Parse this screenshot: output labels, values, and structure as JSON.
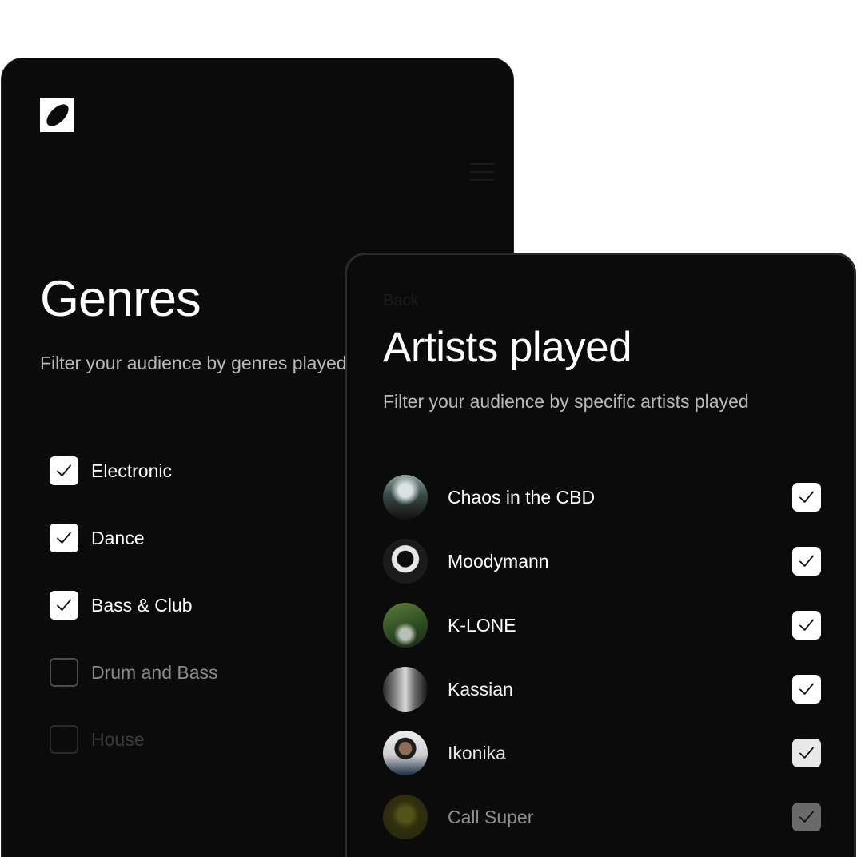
{
  "genres_panel": {
    "logo_icon": "leaf-logo-icon",
    "menu_icon": "hamburger-menu-icon",
    "title": "Genres",
    "subtitle": "Filter your audience by genres played",
    "items": [
      {
        "label": "Electronic",
        "checked": true,
        "label_color": "#ffffff"
      },
      {
        "label": "Dance",
        "checked": true,
        "label_color": "#ffffff"
      },
      {
        "label": "Bass & Club",
        "checked": true,
        "label_color": "#ffffff"
      },
      {
        "label": "Drum and Bass",
        "checked": false,
        "label_color": "#8a8a8a"
      },
      {
        "label": "House",
        "checked": false,
        "label_color": "#3c3c3c"
      }
    ]
  },
  "artists_panel": {
    "back_label": "Back",
    "title": "Artists played",
    "subtitle": "Filter your audience by specific artists played",
    "items": [
      {
        "name": "Chaos in the CBD",
        "checked": true,
        "avatar": "duo-photo-avatar"
      },
      {
        "name": "Moodymann",
        "checked": true,
        "avatar": "sunglasses-portrait-avatar"
      },
      {
        "name": "K-LONE",
        "checked": true,
        "avatar": "forest-portrait-avatar"
      },
      {
        "name": "Kassian",
        "checked": true,
        "avatar": "duo-bw-avatar"
      },
      {
        "name": "Ikonika",
        "checked": true,
        "avatar": "portrait-avatar"
      },
      {
        "name": "Call Super",
        "checked": true,
        "avatar": "yellow-portrait-avatar"
      }
    ]
  },
  "colors": {
    "panel_background": "#0b0b0b",
    "text_primary": "#ffffff",
    "text_secondary": "#b9b9b9",
    "checkbox_checked": "#ffffff"
  }
}
